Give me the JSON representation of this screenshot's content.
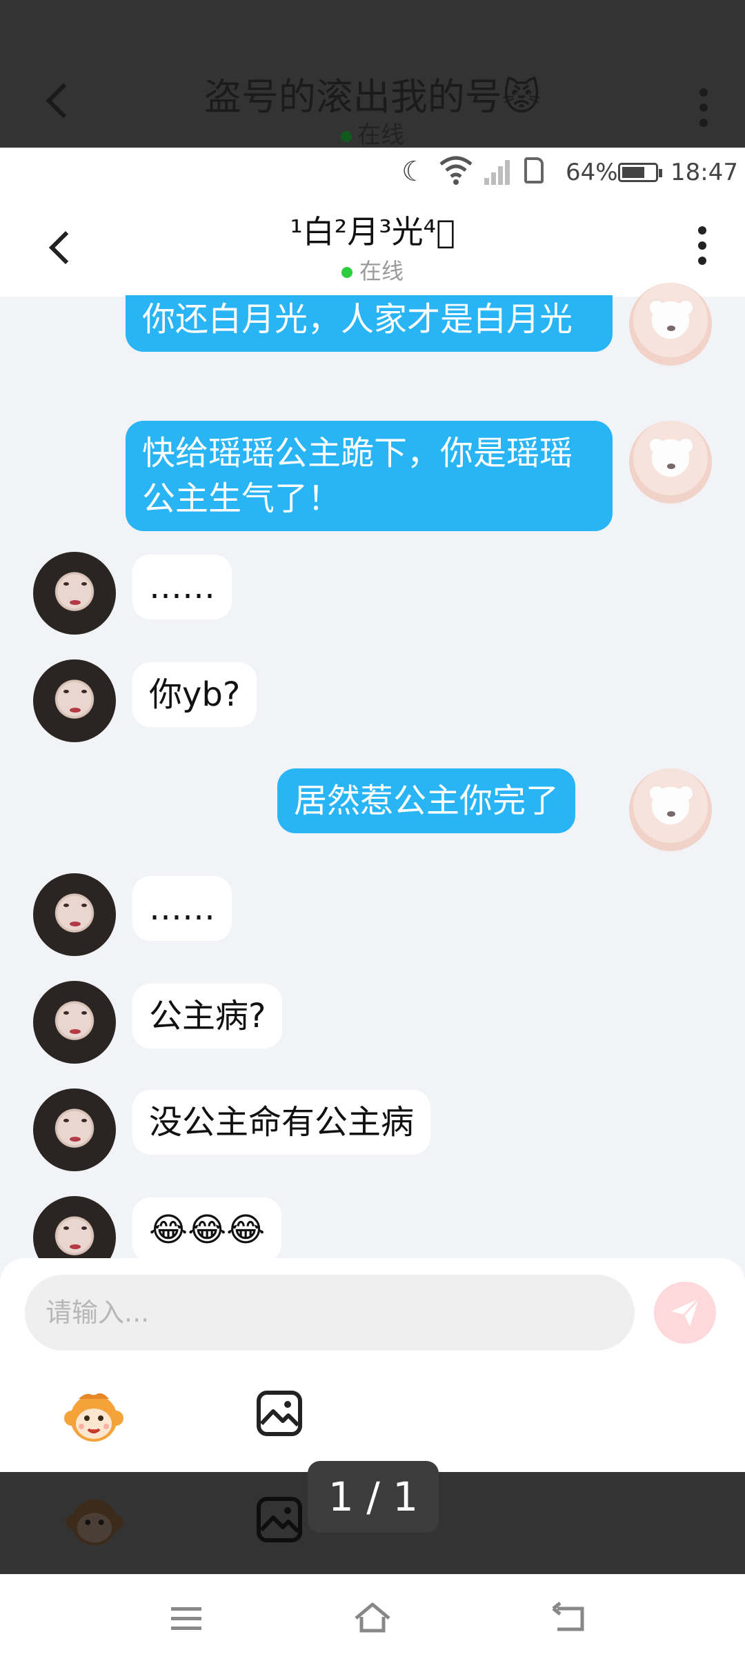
{
  "viewer_overlay": {
    "title": "盗号的滚出我的号😾",
    "status": "在线",
    "page_counter": "1 / 1"
  },
  "status_bar": {
    "battery": "64%",
    "time": "18:47"
  },
  "chat": {
    "title": "¹白²月³光⁴⃣",
    "status": "在线"
  },
  "messages": [
    {
      "side": "out",
      "text": "你还白月光，人家才是白月光"
    },
    {
      "side": "out",
      "text": "快给瑶瑶公主跪下，你是瑶瑶公主生气了！"
    },
    {
      "side": "in",
      "text": "……"
    },
    {
      "side": "in",
      "text": "你yb?"
    },
    {
      "side": "out",
      "text": "居然惹公主你完了"
    },
    {
      "side": "in",
      "text": "……"
    },
    {
      "side": "in",
      "text": "公主病?"
    },
    {
      "side": "in",
      "text": "没公主命有公主病"
    },
    {
      "side": "in",
      "text": "😂😂😂"
    }
  ],
  "composer": {
    "placeholder": "请输入..."
  },
  "colors": {
    "outgoing_bubble": "#29b5f5",
    "incoming_bubble": "#ffffff",
    "online_dot": "#2ecc40",
    "send_button": "#fdd9dc",
    "chat_background": "#f1f3f7"
  },
  "icons": [
    "back-chevron-icon",
    "more-vertical-icon",
    "send-icon",
    "emoji-monkey-icon",
    "image-icon",
    "menu-icon",
    "home-icon",
    "back-icon"
  ]
}
